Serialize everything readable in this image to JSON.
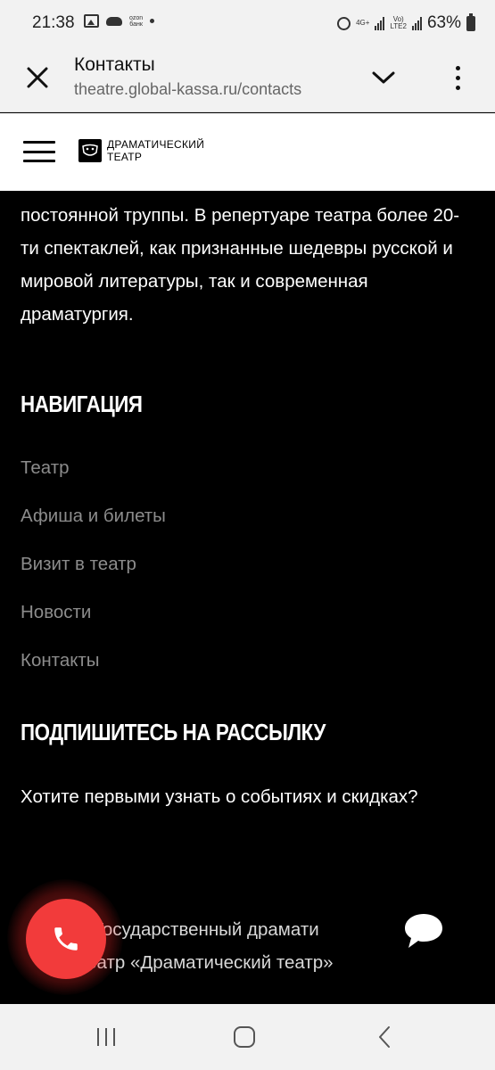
{
  "status_bar": {
    "time": "21:38",
    "ozon_label": "ozon\nбанк",
    "network_label": "4G+",
    "volte_label": "Vo)\nLTE2",
    "battery": "63%"
  },
  "browser": {
    "title": "Контакты",
    "url": "theatre.global-kassa.ru/contacts"
  },
  "site_header": {
    "logo_line1": "ДРАМАТИЧЕСКИЙ",
    "logo_line2": "ТЕАТР"
  },
  "content": {
    "intro": "постоянной труппы. В репертуаре театра более 20-ти спектаклей, как признанные шедевры русской и мировой литературы, так и современная драматургия.",
    "nav_heading": "НАВИГАЦИЯ",
    "nav_items": [
      {
        "label": "Театр"
      },
      {
        "label": "Афиша и билеты"
      },
      {
        "label": "Визит в театр"
      },
      {
        "label": "Новости"
      },
      {
        "label": "Контакты"
      }
    ],
    "subscribe_heading": "ПОДПИШИТЕСЬ НА РАССЫЛКУ",
    "subscribe_text": "Хотите первыми узнать о событиях и скидках?",
    "footer_line1": "4 Государственный драмати",
    "footer_line2": "театр «Драматический театр»"
  },
  "colors": {
    "accent_call": "#f23b3b",
    "nav_link": "#8c8c8c",
    "background": "#000000"
  }
}
